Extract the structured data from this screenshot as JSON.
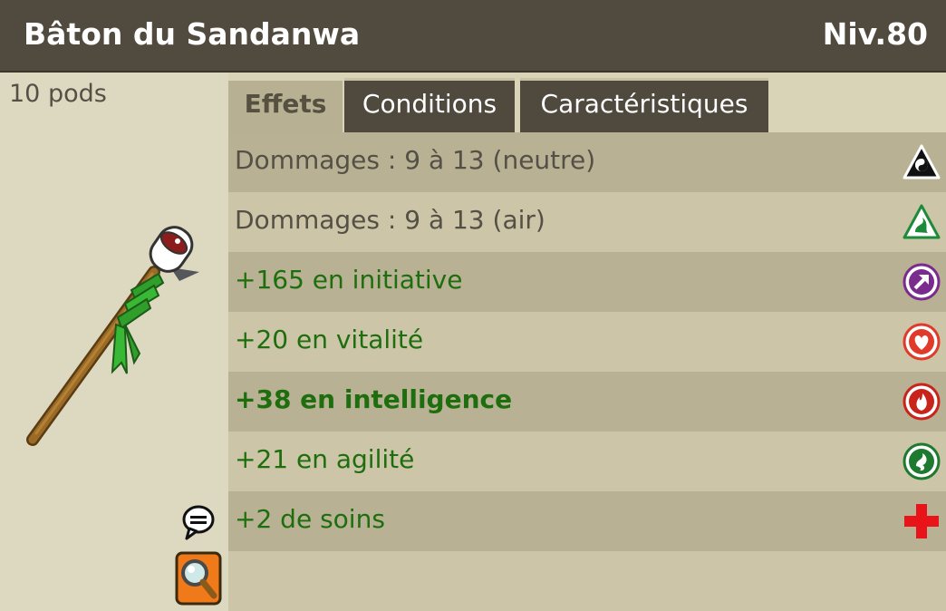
{
  "header": {
    "title": "Bâton du Sandanwa",
    "level": "Niv.80"
  },
  "item": {
    "weight": "10 pods",
    "image_icon": "staff-icon"
  },
  "actions": {
    "chat_icon": "speech-bubble-icon",
    "inspect_icon": "magnifier-icon"
  },
  "tabs": [
    {
      "label": "Effets",
      "active": true
    },
    {
      "label": "Conditions",
      "active": false
    },
    {
      "label": "Caractéristiques",
      "active": false
    }
  ],
  "effects": [
    {
      "text": "Dommages : 9 à 13 (neutre)",
      "icon": "neutral-element-icon",
      "color": "#555046"
    },
    {
      "text": "Dommages : 9 à 13 (air)",
      "icon": "air-element-icon",
      "color": "#555046"
    },
    {
      "text": "+165 en initiative",
      "icon": "initiative-icon",
      "color": "#1e6e0e"
    },
    {
      "text": "+20 en vitalité",
      "icon": "vitality-icon",
      "color": "#1e6e0e"
    },
    {
      "text": "+38 en intelligence",
      "icon": "intelligence-icon",
      "color": "#1e6e0e",
      "bold": true
    },
    {
      "text": "+21 en agilité",
      "icon": "agility-icon",
      "color": "#1e6e0e"
    },
    {
      "text": "+2 de soins",
      "icon": "heal-icon",
      "color": "#1e6e0e"
    }
  ],
  "colors": {
    "header_bg": "#514a3e",
    "tab_active_bg": "#b7b092",
    "tab_bg": "#4f493e",
    "row_dark": "#b8b194",
    "row_light": "#ccc5a7",
    "bonus_text": "#1e6e0e"
  }
}
